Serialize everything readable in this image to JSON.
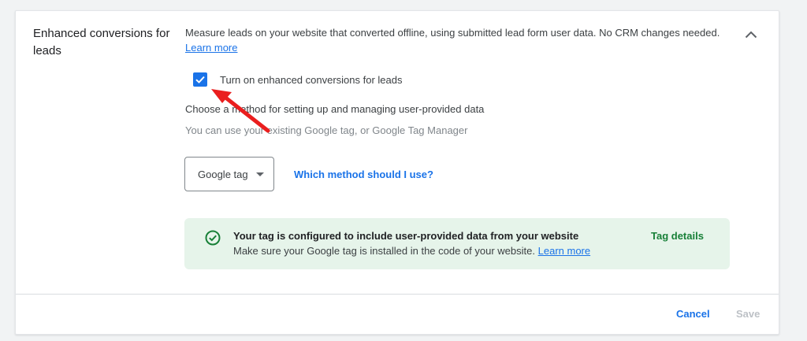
{
  "section": {
    "title": "Enhanced conversions for leads",
    "description": "Measure leads on your website that converted offline, using submitted lead form user data. No CRM changes needed.",
    "learn_more": "Learn more"
  },
  "checkbox": {
    "label": "Turn on enhanced conversions for leads",
    "checked": true
  },
  "method": {
    "title": "Choose a method for setting up and managing user-provided data",
    "subtitle": "You can use your existing Google tag, or Google Tag Manager",
    "dropdown_value": "Google tag",
    "help_link": "Which method should I use?"
  },
  "banner": {
    "title": "Your tag is configured to include user-provided data from your website",
    "body": "Make sure your Google tag is installed in the code of your website.",
    "learn_more": "Learn more",
    "action": "Tag details"
  },
  "footer": {
    "cancel": "Cancel",
    "save": "Save"
  },
  "colors": {
    "accent": "#1a73e8",
    "success": "#188038",
    "banner_bg": "#e6f4ea",
    "annotation_arrow": "#ea1e1e"
  },
  "icons": [
    "chevron-up-icon",
    "checkmark-icon",
    "dropdown-caret-icon",
    "check-circle-icon",
    "annotation-arrow"
  ]
}
